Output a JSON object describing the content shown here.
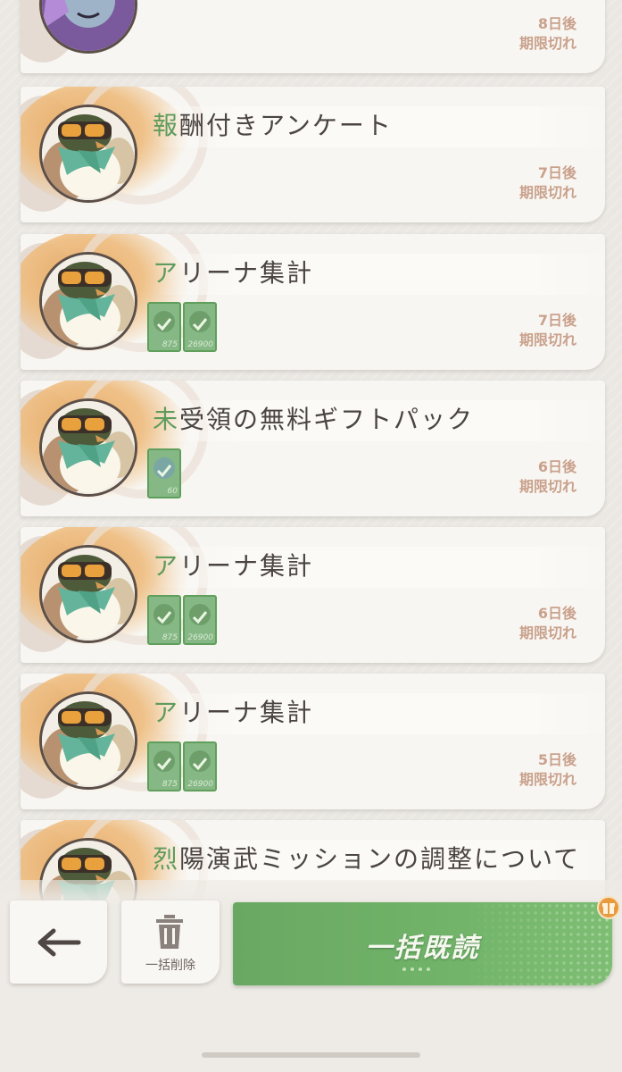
{
  "colors": {
    "accent_green": "#6aaa63",
    "title_text": "#4b4440",
    "expiry_text": "#c9a18c",
    "card_bg": "#f8f6f2"
  },
  "mails": [
    {
      "title": "",
      "expiry_days": "8日後",
      "expiry_label": "期限切れ",
      "avatar": "purple-character-avatar",
      "rewards": []
    },
    {
      "title_first": "報",
      "title_rest": "酬付きアンケート",
      "expiry_days": "7日後",
      "expiry_label": "期限切れ",
      "avatar": "goggle-bird-avatar",
      "rewards": []
    },
    {
      "title_first": "ア",
      "title_rest": "リーナ集計",
      "expiry_days": "7日後",
      "expiry_label": "期限切れ",
      "avatar": "goggle-bird-avatar",
      "rewards": [
        {
          "qty": "875",
          "claimed": true
        },
        {
          "qty": "26900",
          "claimed": true
        }
      ]
    },
    {
      "title_first": "未",
      "title_rest": "受領の無料ギフトパック",
      "expiry_days": "6日後",
      "expiry_label": "期限切れ",
      "avatar": "goggle-bird-avatar",
      "rewards": [
        {
          "qty": "60",
          "claimed": true
        }
      ]
    },
    {
      "title_first": "ア",
      "title_rest": "リーナ集計",
      "expiry_days": "6日後",
      "expiry_label": "期限切れ",
      "avatar": "goggle-bird-avatar",
      "rewards": [
        {
          "qty": "875",
          "claimed": true
        },
        {
          "qty": "26900",
          "claimed": true
        }
      ]
    },
    {
      "title_first": "ア",
      "title_rest": "リーナ集計",
      "expiry_days": "5日後",
      "expiry_label": "期限切れ",
      "avatar": "goggle-bird-avatar",
      "rewards": [
        {
          "qty": "875",
          "claimed": true
        },
        {
          "qty": "26900",
          "claimed": true
        }
      ]
    },
    {
      "title_first": "烈",
      "title_rest": "陽演武ミッションの調整について",
      "expiry_days": "",
      "expiry_label": "",
      "avatar": "goggle-bird-avatar",
      "rewards": []
    }
  ],
  "bottom_bar": {
    "back_icon": "arrow-left-icon",
    "delete_icon": "trash-icon",
    "delete_label": "一括削除",
    "read_all_label": "一括既読",
    "gift_icon": "gift-badge-icon"
  }
}
